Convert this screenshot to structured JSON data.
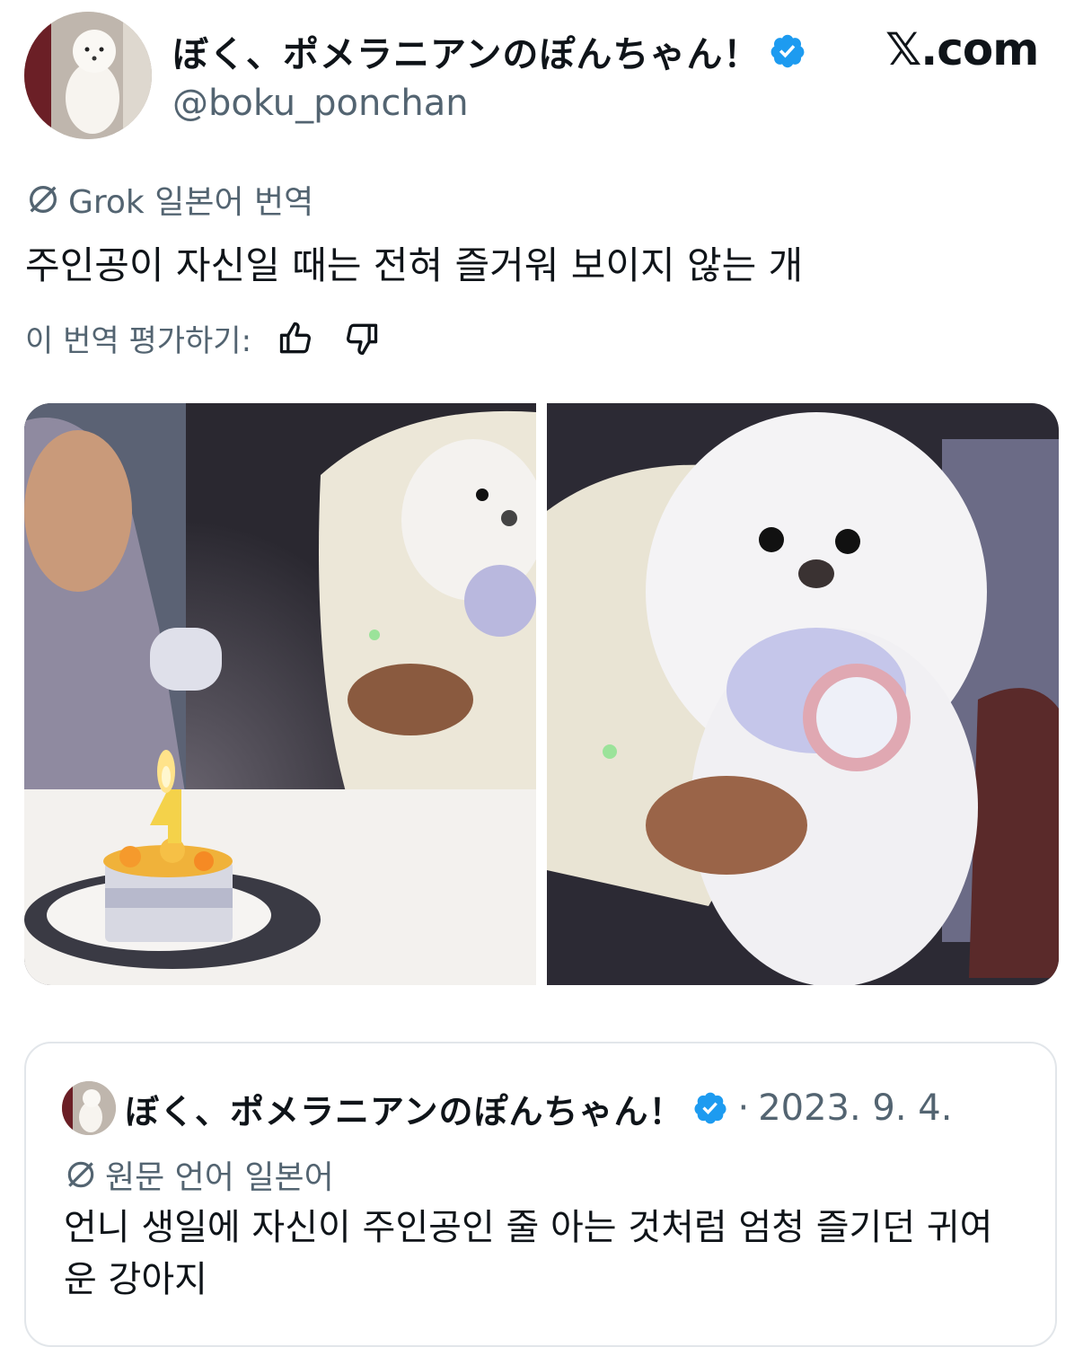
{
  "author": {
    "display_name": "ぼく、ポメラニアンのぽんちゃん！",
    "handle": "@boku_ponchan",
    "verified_icon": "verified-badge-icon",
    "verified_color": "#1d9bf0"
  },
  "brand": {
    "label": "𝕏.com"
  },
  "translation_header": {
    "icon": "translate-icon",
    "label": "Grok 일본어 번역"
  },
  "translated_text": "주인공이 자신일 때는 전혀 즐거워 보이지 않는 개",
  "rating": {
    "label": "이 번역 평가하기:",
    "up_icon": "thumbs-up-icon",
    "down_icon": "thumbs-down-icon"
  },
  "media": {
    "photos": [
      "birthday-cake-photo",
      "pomeranian-photo"
    ],
    "cake_candle_number": "4"
  },
  "quoted_post": {
    "display_name": "ぼく、ポメラニアンのぽんちゃん！",
    "separator": "·",
    "date": "2023. 9. 4.",
    "language_label": "원문 언어 일본어",
    "text": "언니 생일에 자신이 주인공인 줄 아는 것처럼 엄청 즐기던 귀여운 강아지"
  },
  "colors": {
    "text": "#0f1419",
    "secondary": "#536471",
    "border": "#e2e6ea"
  }
}
